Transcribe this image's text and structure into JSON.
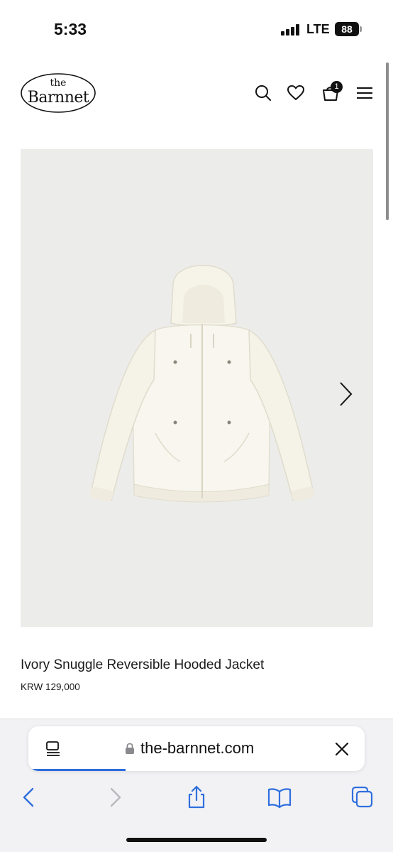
{
  "status_bar": {
    "time": "5:33",
    "network": "LTE",
    "battery": "88"
  },
  "header": {
    "logo_small": "the",
    "logo_name": "Barnnet",
    "cart_count": "1",
    "icons": [
      "search-icon",
      "heart-icon",
      "cart-icon",
      "menu-icon"
    ]
  },
  "product": {
    "title": "Ivory Snuggle Reversible Hooded Jacket",
    "price": "KRW 129,000"
  },
  "browser": {
    "url": "the-barnnet.com",
    "load_progress": 0.29,
    "accent": "#2f6fde",
    "toolbar_icons": [
      "back-icon",
      "forward-icon",
      "share-icon",
      "bookmarks-icon",
      "tabs-icon"
    ]
  }
}
